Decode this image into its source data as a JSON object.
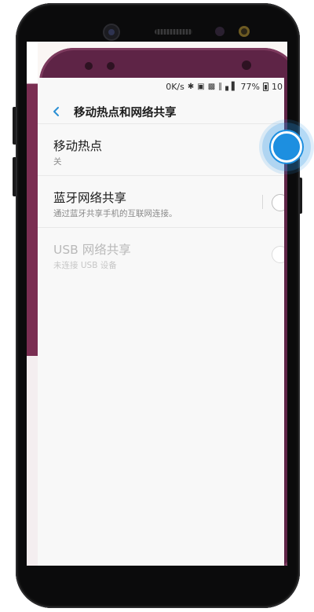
{
  "status_bar": {
    "speed": "0K/s",
    "battery_percent": "77%",
    "extra": "10",
    "icons": [
      "bluetooth-icon",
      "nfc-icon",
      "mute-icon",
      "lte-icon",
      "signal-icon",
      "battery-icon"
    ]
  },
  "header": {
    "back_icon": "chevron-left-icon",
    "title": "移动热点和网络共享"
  },
  "settings": [
    {
      "title": "移动热点",
      "subtitle": "关",
      "enabled": true,
      "toggle": "on-target"
    },
    {
      "title": "蓝牙网络共享",
      "subtitle": "通过蓝牙共享手机的互联网连接。",
      "enabled": true,
      "toggle": "off"
    },
    {
      "title": "USB 网络共享",
      "subtitle": "未连接 USB 设备",
      "enabled": false,
      "toggle": "off"
    }
  ],
  "colors": {
    "accent": "#1d8fe0",
    "back_arrow": "#2a8fd4",
    "text_primary": "#1b1b1b",
    "text_secondary": "#8a8a8a",
    "text_disabled": "#b9b9b9",
    "background": "#f8f8f8",
    "phone_body": "#0b0b0c",
    "wallpaper": "#5e2446"
  }
}
